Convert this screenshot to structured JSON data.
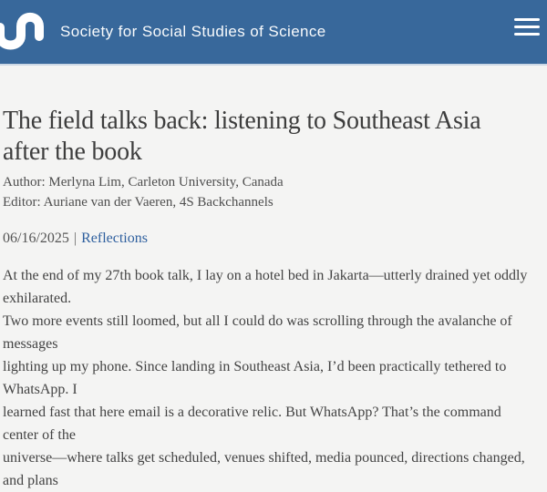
{
  "header": {
    "brand": "Society for Social Studies of Science",
    "background_color": "#38689b",
    "logo_icon": "4s-wave-logo",
    "menu_icon": "hamburger-menu"
  },
  "article": {
    "title": "The field talks back: listening to Southeast Asia after the book",
    "title_lines": [
      "The field talks back: listening to Southeast Asia",
      "after the book"
    ],
    "byline": {
      "author": "Author: Merlyna Lim, Carleton University, Canada",
      "editor": "Editor: Auriane van der Vaeren, 4S Backchannels"
    },
    "meta": {
      "date": "06/16/2025",
      "separator": "|",
      "category": "Reflections",
      "category_color": "#2e5f9e"
    },
    "body_lines": [
      "At the end of my 27th book talk, I lay on a hotel bed in Jakarta—utterly drained yet oddly exhilarated.",
      "Two more events still loomed, but all I could do was scrolling through the avalanche of messages",
      "lighting up my phone. Since landing in Southeast Asia, I’d been practically tethered to WhatsApp. I",
      "learned fast that here email is a decorative relic. But WhatsApp? That’s the command center of the",
      "universe—where talks get scheduled, venues shifted, media pounced, directions changed, and plans"
    ]
  }
}
